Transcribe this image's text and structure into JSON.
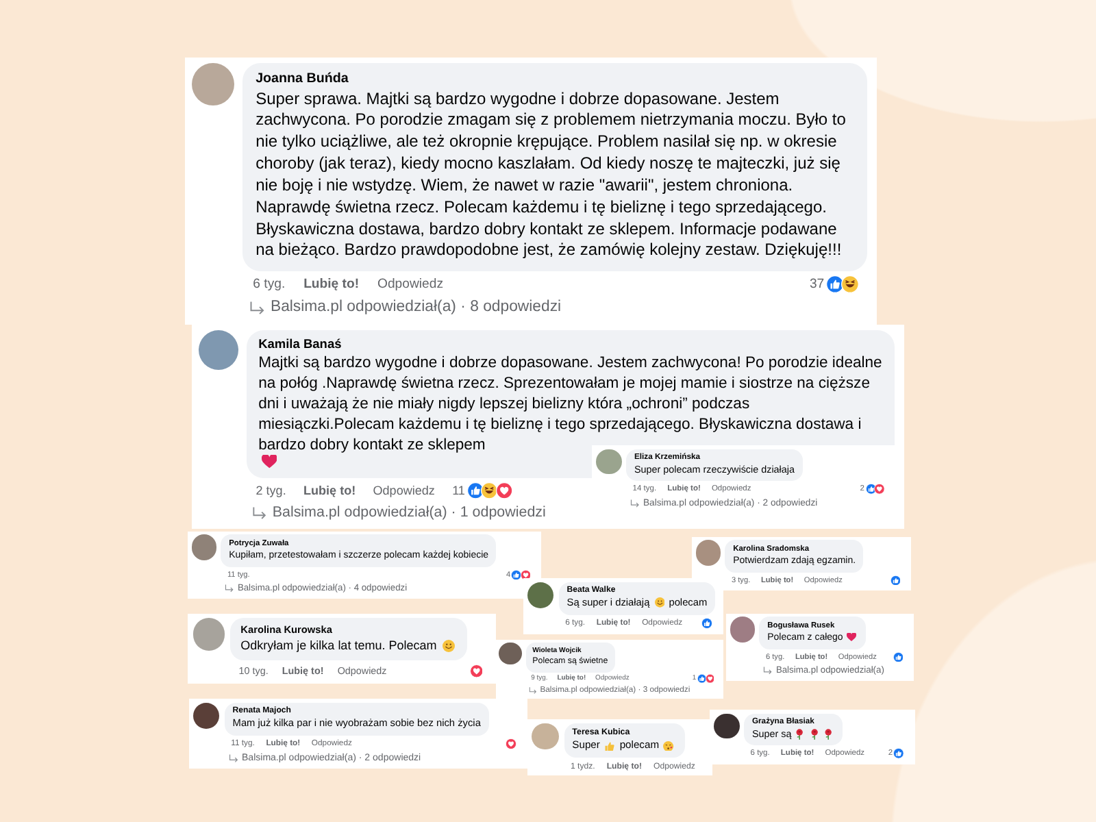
{
  "comments": [
    {
      "author": "Joanna Buńda",
      "body": [
        {
          "kind": "text",
          "text": "Super sprawa. Majtki są bardzo wygodne i dobrze dopasowane. Jestem zachwycona. Po porodzie zmagam się z problemem nietrzymania moczu. Było to nie tylko uciążliwe, ale też okropnie krępujące. Problem nasilał się np. w okresie choroby (jak teraz), kiedy mocno kaszlałam. Od kiedy noszę te majteczki, już się nie boję i nie wstydzę. Wiem, że nawet w razie \"awarii\", jestem chroniona. Naprawdę świetna rzecz. Polecam każdemu i tę bieliznę i tego sprzedającego. Błyskawiczna dostawa, bardzo dobry kontakt ze sklepem. Informacje podawane na bieżąco. Bardzo prawdopodobne jest, że zamówię kolejny zestaw. Dziękuję!!!"
        }
      ],
      "time": "6 tyg.",
      "like": "Lubię to!",
      "reply": "Odpowiedz",
      "reaction_count": "37",
      "reactions": [
        {
          "kind": "like"
        },
        {
          "kind": "haha"
        }
      ],
      "replies": "Balsima.pl odpowiedział(a) · 8 odpowiedzi"
    },
    {
      "author": "Kamila Banaś",
      "body": [
        {
          "kind": "text",
          "text": "Majtki są bardzo wygodne i dobrze dopasowane. Jestem zachwycona! Po porodzie idealne na połóg .Naprawdę świetna rzecz. Sprezentowałam je mojej mamie i siostrze na cięższe dni i uważają że nie miały nigdy lepszej bielizny która „ochroni” podczas miesiączki.Polecam każdemu i tę bieliznę i tego sprzedającego. Błyskawiczna dostawa i bardzo dobry kontakt ze sklepem"
        },
        {
          "kind": "heart"
        }
      ],
      "time": "2 tyg.",
      "like": "Lubię to!",
      "reply": "Odpowiedz",
      "reaction_count": "11",
      "reactions": [
        {
          "kind": "like"
        },
        {
          "kind": "haha"
        },
        {
          "kind": "love"
        }
      ],
      "replies": "Balsima.pl odpowiedział(a) · 1 odpowiedzi"
    },
    {
      "author": "Eliza Krzemińska",
      "body": [
        {
          "kind": "text",
          "text": "Super polecam rzeczywiście działaja"
        }
      ],
      "time": "14 tyg.",
      "like": "Lubię to!",
      "reply": "Odpowiedz",
      "reaction_count": "2",
      "reactions": [
        {
          "kind": "like"
        },
        {
          "kind": "love"
        }
      ],
      "replies": "Balsima.pl odpowiedział(a) · 2 odpowiedzi"
    },
    {
      "author": "Potrycja Zuwała",
      "body": [
        {
          "kind": "text",
          "text": "Kupiłam, przetestowałam i szczerze polecam każdej kobiecie"
        }
      ],
      "time": "11 tyg.",
      "reaction_count": "4",
      "reactions": [
        {
          "kind": "like"
        },
        {
          "kind": "love"
        }
      ],
      "replies": "Balsima.pl odpowiedział(a) · 4 odpowiedzi"
    },
    {
      "author": "Karolina Sradomska",
      "body": [
        {
          "kind": "text",
          "text": "Potwierdzam zdają egzamin."
        }
      ],
      "time": "3 tyg.",
      "like": "Lubię to!",
      "reply": "Odpowiedz",
      "reactions": [
        {
          "kind": "like"
        }
      ]
    },
    {
      "author": "Karolina Kurowska",
      "body": [
        {
          "kind": "text",
          "text": "Odkryłam je kilka lat temu. Polecam"
        },
        {
          "kind": "smile"
        }
      ],
      "time": "10 tyg.",
      "like": "Lubię to!",
      "reply": "Odpowiedz",
      "reactions": [
        {
          "kind": "love"
        }
      ]
    },
    {
      "author": "Beata Walke",
      "body": [
        {
          "kind": "text",
          "text": "Są super i działają"
        },
        {
          "kind": "smile"
        },
        {
          "kind": "text",
          "text": "polecam"
        }
      ],
      "time": "6 tyg.",
      "like": "Lubię to!",
      "reply": "Odpowiedz",
      "reactions": [
        {
          "kind": "like"
        }
      ]
    },
    {
      "author": "Bogusława Rusek",
      "body": [
        {
          "kind": "text",
          "text": "Polecam z całego"
        },
        {
          "kind": "heart"
        }
      ],
      "time": "6 tyg.",
      "like": "Lubię to!",
      "reply": "Odpowiedz",
      "reactions": [
        {
          "kind": "like"
        }
      ],
      "replies": "Balsima.pl odpowiedział(a)"
    },
    {
      "author": "Wioleta Wojcik",
      "body": [
        {
          "kind": "text",
          "text": "Polecam są świetne"
        }
      ],
      "time": "9 tyg.",
      "like": "Lubię to!",
      "reply": "Odpowiedz",
      "reaction_count": "1",
      "reactions": [
        {
          "kind": "like"
        },
        {
          "kind": "love"
        }
      ],
      "replies": "Balsima.pl odpowiedział(a) · 3 odpowiedzi"
    },
    {
      "author": "Renata Majoch",
      "body": [
        {
          "kind": "text",
          "text": "Mam już kilka par i nie wyobrażam sobie bez nich życia"
        }
      ],
      "time": "11 tyg.",
      "like": "Lubię to!",
      "reply": "Odpowiedz",
      "reactions": [
        {
          "kind": "love"
        }
      ],
      "replies": "Balsima.pl odpowiedział(a) · 2 odpowiedzi"
    },
    {
      "author": "Teresa Kubica",
      "body": [
        {
          "kind": "text",
          "text": "Super"
        },
        {
          "kind": "thumb"
        },
        {
          "kind": "text",
          "text": "polecam"
        },
        {
          "kind": "kiss"
        }
      ],
      "time": "1 tydz.",
      "like": "Lubię to!",
      "reply": "Odpowiedz"
    },
    {
      "author": "Grażyna Błasiak",
      "body": [
        {
          "kind": "text",
          "text": "Super są"
        },
        {
          "kind": "rose"
        },
        {
          "kind": "rose"
        },
        {
          "kind": "rose"
        }
      ],
      "time": "6 tyg.",
      "like": "Lubię to!",
      "reply": "Odpowiedz",
      "reaction_count": "2",
      "reactions": [
        {
          "kind": "like"
        }
      ]
    }
  ]
}
